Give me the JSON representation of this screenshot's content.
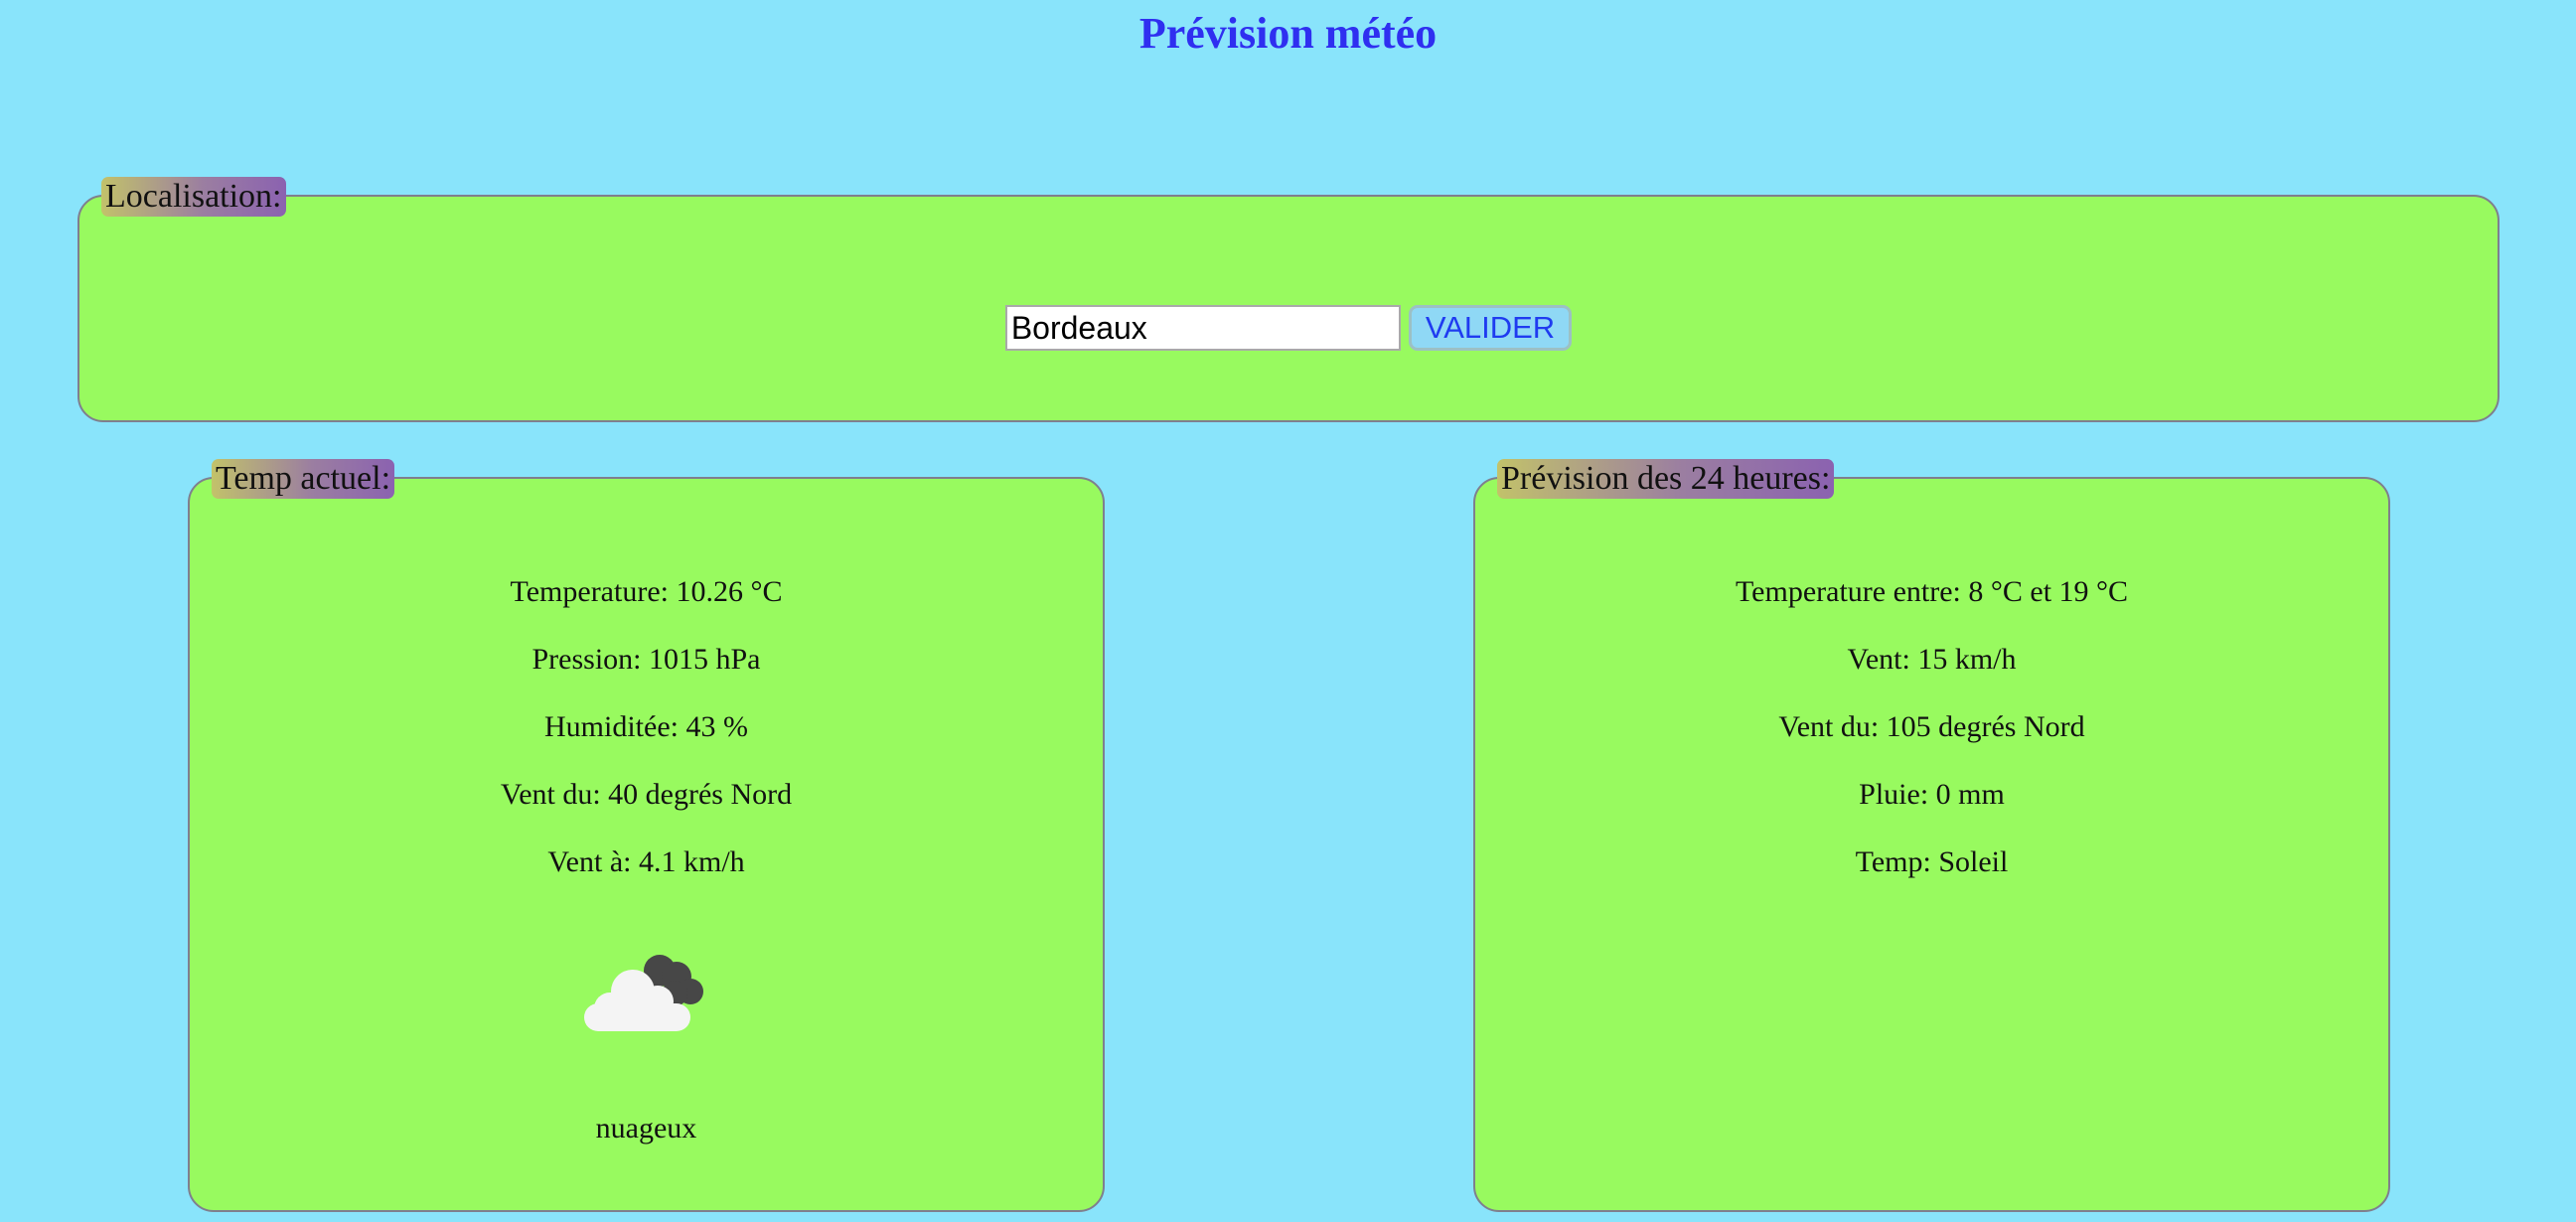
{
  "page": {
    "title": "Prévision météo"
  },
  "location": {
    "legend": "Localisation:",
    "input_value": "Bordeaux",
    "validate_label": "VALIDER"
  },
  "current": {
    "legend": "Temp actuel:",
    "lines": [
      "Temperature: 10.26 °C",
      "Pression: 1015 hPa",
      "Humiditée: 43 %",
      "Vent du: 40 degrés Nord",
      "Vent à: 4.1 km/h"
    ],
    "icon": "cloudy-icon",
    "condition": "nuageux"
  },
  "forecast": {
    "legend": "Prévision des 24 heures:",
    "lines": [
      "Temperature entre: 8 °C et 19 °C",
      "Vent: 15 km/h",
      "Vent du: 105 degrés Nord",
      "Pluie: 0 mm",
      "Temp: Soleil"
    ]
  },
  "colors": {
    "background": "#89e4fb",
    "panel": "#98fa5f",
    "title": "#2f2ff0",
    "button_text": "#1f3bf0",
    "button_bg": "#8fd8f5"
  }
}
